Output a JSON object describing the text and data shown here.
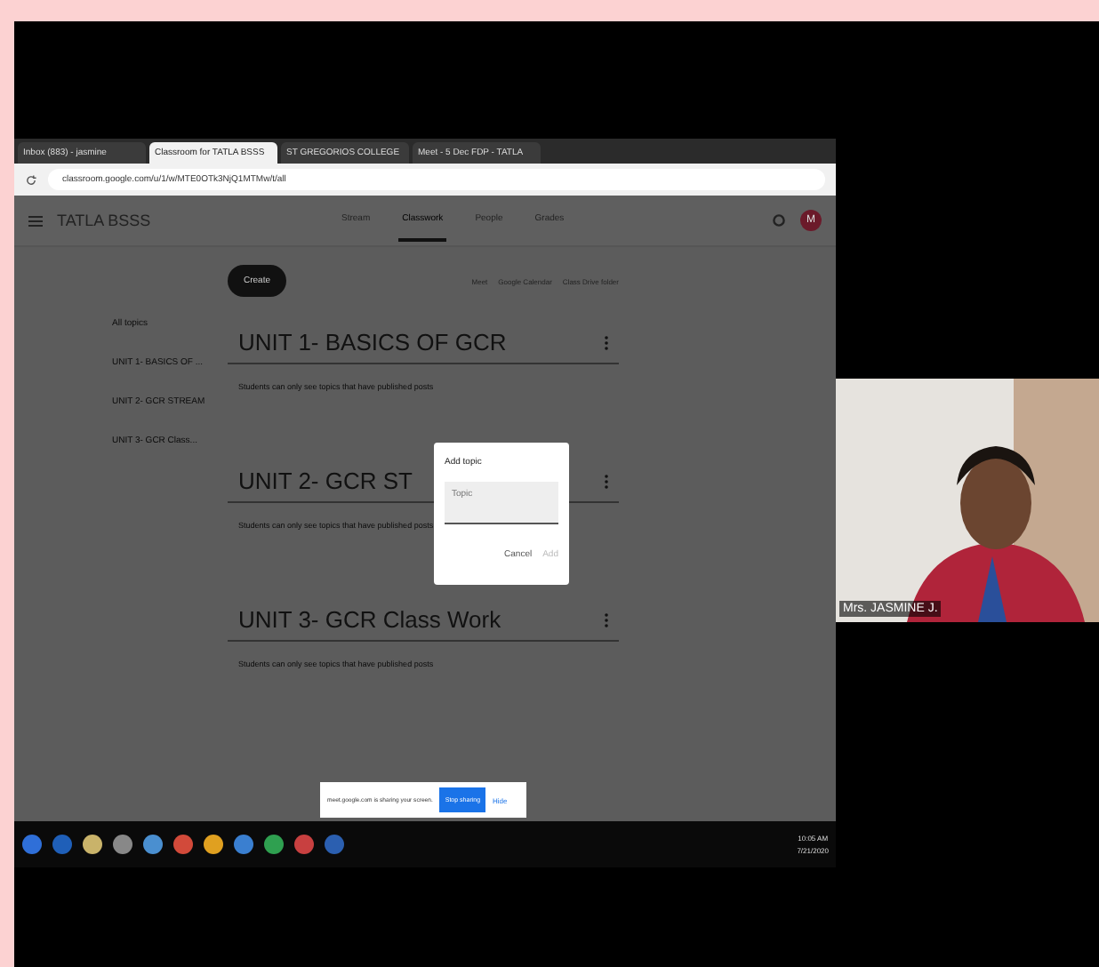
{
  "browser": {
    "tabs": [
      {
        "label": "Inbox (883) - jasmine",
        "selected": false
      },
      {
        "label": "Classroom for TATLA BSSS",
        "selected": true
      },
      {
        "label": "ST GREGORIOS COLLEGE",
        "selected": false
      },
      {
        "label": "Meet - 5 Dec FDP - TATLA",
        "selected": false
      }
    ],
    "address": "classroom.google.com/u/1/w/MTE0OTk3NjQ1MTMw/t/all"
  },
  "app": {
    "title": "TATLA BSSS",
    "nav": [
      {
        "label": "Stream",
        "selected": false
      },
      {
        "label": "Classwork",
        "selected": true
      },
      {
        "label": "People",
        "selected": false
      },
      {
        "label": "Grades",
        "selected": false
      }
    ],
    "avatar": "M",
    "create": "Create",
    "links": [
      "Meet",
      "Google Calendar",
      "Class Drive folder"
    ],
    "topics": [
      "All topics",
      "UNIT 1- BASICS OF ...",
      "UNIT 2- GCR STREAM",
      "UNIT 3- GCR Class..."
    ],
    "units": [
      {
        "title": "UNIT 1- BASICS OF GCR",
        "note": "Students can only see topics that have published posts"
      },
      {
        "title": "UNIT 2- GCR ST",
        "note": "Students can only see topics that have published posts"
      },
      {
        "title": "UNIT 3- GCR Class Work",
        "note": "Students can only see topics that have published posts"
      }
    ]
  },
  "dialog": {
    "title": "Add topic",
    "placeholder": "Topic",
    "cancel": "Cancel",
    "add": "Add"
  },
  "share_bar": {
    "message": "meet.google.com is sharing your screen.",
    "stop": "Stop sharing",
    "hide": "Hide"
  },
  "taskbar": {
    "time": "10:05 AM",
    "date": "7/21/2020"
  },
  "video": {
    "name": "Mrs. JASMINE J."
  }
}
